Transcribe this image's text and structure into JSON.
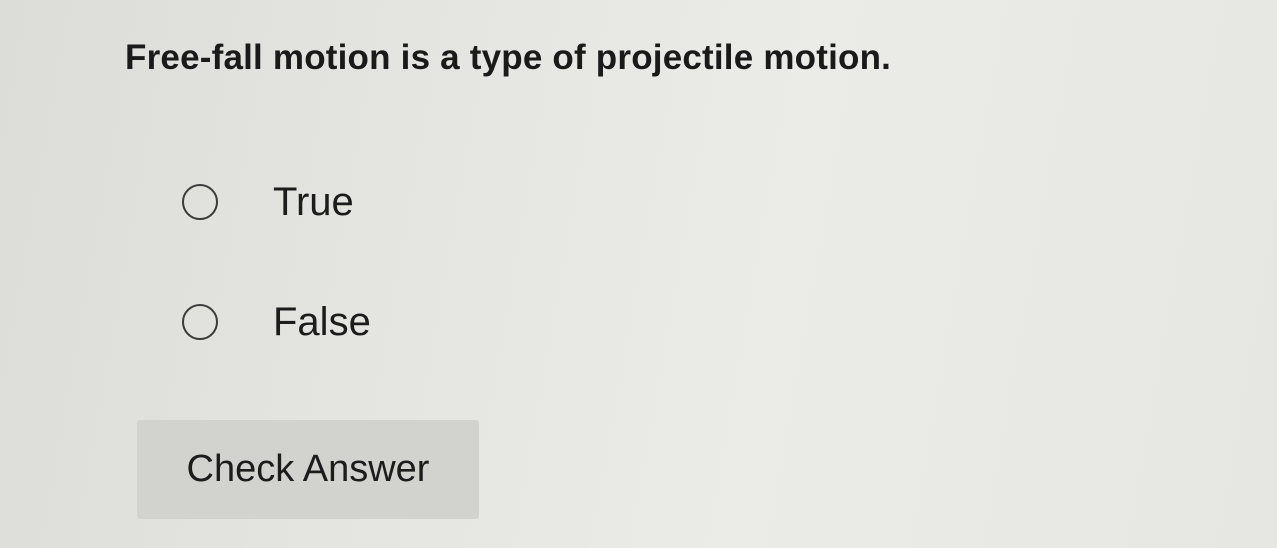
{
  "question": {
    "text": "Free-fall motion is a type of projectile motion."
  },
  "options": [
    {
      "label": "True",
      "selected": false
    },
    {
      "label": "False",
      "selected": false
    }
  ],
  "actions": {
    "check_answer_label": "Check Answer"
  }
}
